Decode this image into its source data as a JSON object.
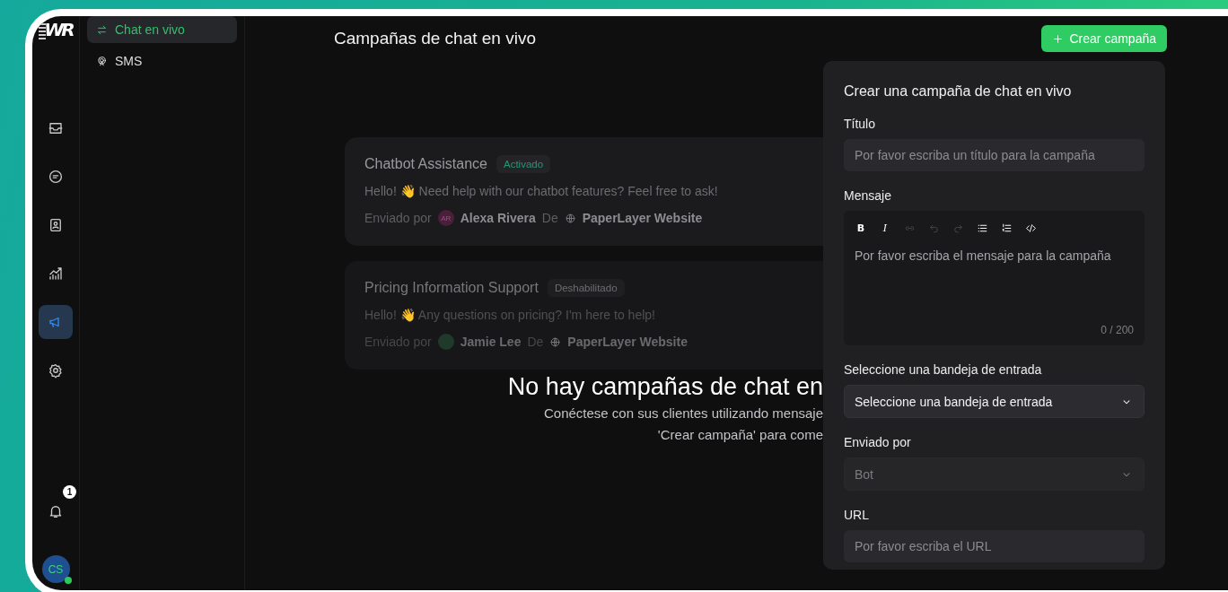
{
  "logo": {
    "text": "WR"
  },
  "rail": {
    "items": [
      {
        "selected": false
      },
      {
        "selected": false
      },
      {
        "selected": false
      },
      {
        "selected": false
      },
      {
        "selected": true
      },
      {
        "selected": false
      }
    ],
    "notifications": {
      "count": "1"
    },
    "avatar": {
      "initials": "CS",
      "online": true
    }
  },
  "sidebar": {
    "items": [
      {
        "label": "Chat en vivo",
        "selected": true
      },
      {
        "label": "SMS",
        "selected": false
      }
    ]
  },
  "header": {
    "title": "Campañas de chat en vivo",
    "button": "Crear campaña"
  },
  "campaigns": [
    {
      "name": "Chatbot Assistance",
      "status": "Activado",
      "active": true,
      "message": "Hello! 👋 Need help with our chatbot features? Feel free to ask!",
      "sent_by_label": "Enviado por",
      "sender_initials": "AR",
      "color": "#4a1f3a",
      "sender": "Alexa Rivera",
      "from_label": "De",
      "inbox": "PaperLayer Website"
    },
    {
      "name": "Pricing Information Support",
      "status": "Deshabilitado",
      "active": false,
      "message": "Hello! 👋 Any questions on pricing? I'm here to help!",
      "sent_by_label": "Enviado por",
      "color": "#1f3a2a",
      "sender": "Jamie Lee",
      "from_label": "De",
      "inbox": "PaperLayer Website"
    }
  ],
  "empty_state": {
    "title": "No hay campañas de chat en",
    "lines": [
      "Conéctese con sus clientes utilizando mensaje",
      "'Crear campaña' para come"
    ]
  },
  "panel": {
    "title": "Crear una campaña de chat en vivo",
    "fields": [
      {
        "kind": "text",
        "label": "Título",
        "placeholder": "Por favor escriba un título para la campaña"
      },
      {
        "kind": "editor",
        "label": "Mensaje",
        "placeholder": "Por favor escriba el mensaje para la campaña",
        "counter": "0 / 200",
        "tools": [
          {
            "kind": "bold",
            "glyph": "B",
            "disabled": false
          },
          {
            "kind": "italic",
            "glyph": "I",
            "disabled": false
          },
          {
            "kind": "link",
            "disabled": true
          },
          {
            "kind": "undo",
            "disabled": true
          },
          {
            "kind": "redo",
            "disabled": true
          },
          {
            "kind": "bullet-list",
            "disabled": false
          },
          {
            "kind": "numbered-list",
            "disabled": false
          },
          {
            "kind": "code",
            "disabled": false
          }
        ]
      },
      {
        "kind": "select",
        "label": "Seleccione una bandeja de entrada",
        "value": "Seleccione una bandeja de entrada",
        "disabled": false
      },
      {
        "kind": "select",
        "label": "Enviado por",
        "value": "Bot",
        "disabled": true
      },
      {
        "kind": "text",
        "label": "URL",
        "placeholder": "Por favor escriba el URL"
      }
    ]
  }
}
